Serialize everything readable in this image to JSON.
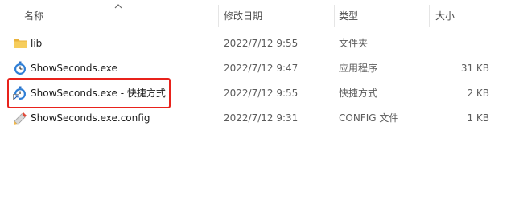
{
  "columns": {
    "name": "名称",
    "modified": "修改日期",
    "type": "类型",
    "size": "大小"
  },
  "files": [
    {
      "icon": "folder-icon",
      "name": "lib",
      "modified": "2022/7/12 9:55",
      "type": "文件夹",
      "size": ""
    },
    {
      "icon": "app-icon",
      "name": "ShowSeconds.exe",
      "modified": "2022/7/12 9:47",
      "type": "应用程序",
      "size": "31 KB"
    },
    {
      "icon": "shortcut-icon",
      "name": "ShowSeconds.exe - 快捷方式",
      "modified": "2022/7/12 9:55",
      "type": "快捷方式",
      "size": "2 KB"
    },
    {
      "icon": "config-file-icon",
      "name": "ShowSeconds.exe.config",
      "modified": "2022/7/12 9:31",
      "type": "CONFIG 文件",
      "size": "1 KB"
    }
  ],
  "colors": {
    "highlight": "#e8221b",
    "folder": "#f2c14e",
    "app_icon": "#2f7fd6"
  }
}
